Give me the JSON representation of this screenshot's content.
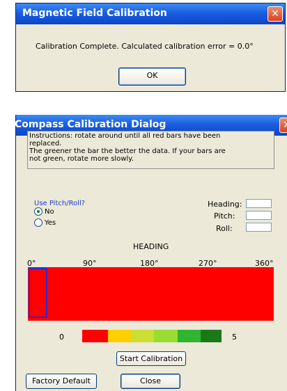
{
  "dialog1": {
    "title": "Magnetic Field Calibration",
    "close_glyph": "✕",
    "message": "Calibration Complete.  Calculated calibration error = 0.0°",
    "ok_label": "OK"
  },
  "dialog2": {
    "title": "Compass Calibration Dialog",
    "close_glyph": "✕",
    "instructions": [
      "Instructions: rotate around until all red bars have been",
      "replaced.",
      "The greener the bar the better the data.  If your bars are",
      "not green, rotate more slowly."
    ],
    "pitch_roll_question": "Use Pitch/Roll?",
    "radio_no": "No",
    "radio_yes": "Yes",
    "radio_selected": "No",
    "heading_field_label": "Heading:",
    "pitch_field_label": "Pitch:",
    "roll_field_label": "Roll:",
    "heading_title": "HEADING",
    "ticks": [
      "0°",
      "90°",
      "180°",
      "270°",
      "360°"
    ],
    "bar_color": "#ff0000",
    "legend_min": "0",
    "legend_max": "5",
    "legend_colors": [
      "#ff0000",
      "#ffd000",
      "#ccdd33",
      "#99dd33",
      "#2fb52f",
      "#1a7a1a"
    ],
    "start_label": "Start Calibration",
    "factory_label": "Factory Default",
    "close_label": "Close"
  }
}
